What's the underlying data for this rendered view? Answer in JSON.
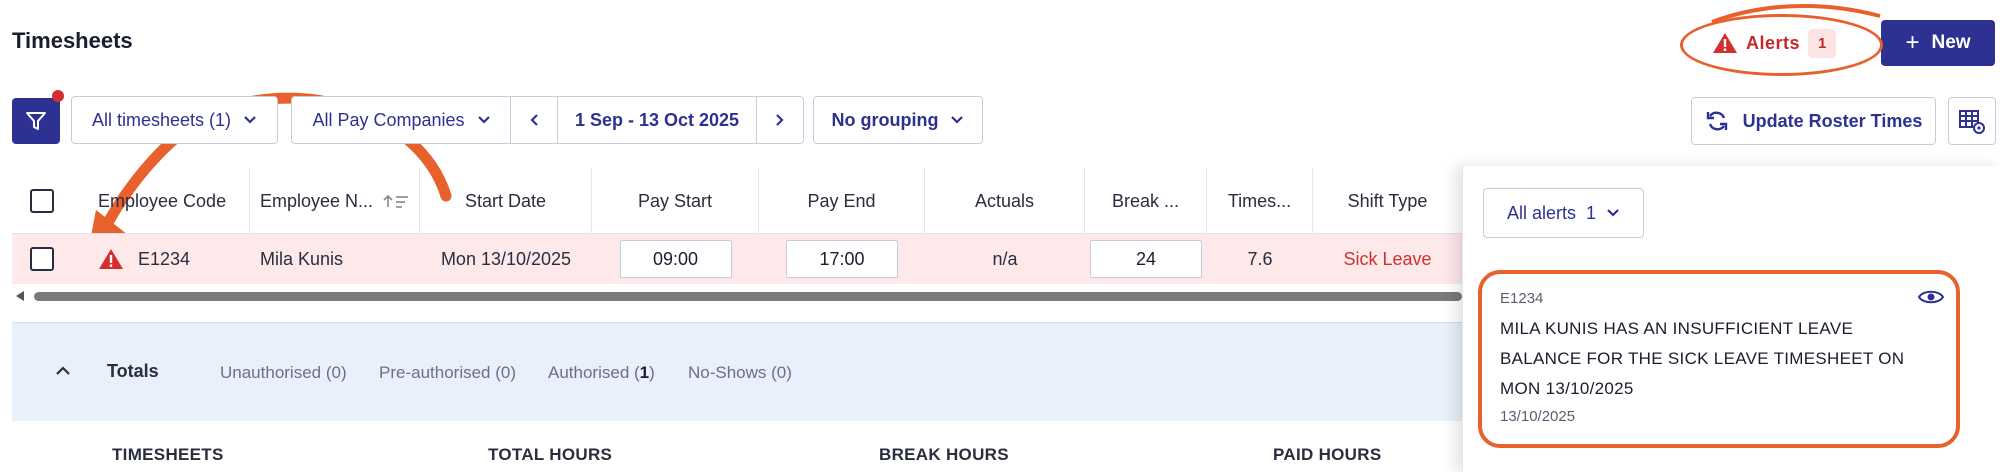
{
  "page": {
    "title": "Timesheets"
  },
  "header": {
    "alerts_label": "Alerts",
    "alerts_count": "1",
    "new_label": "New",
    "accent_color": "#2d3292",
    "alert_color": "#c62828"
  },
  "filters": {
    "timesheets": "All timesheets (1)",
    "pay_companies": "All Pay Companies",
    "date_range": "1 Sep - 13 Oct 2025",
    "grouping": "No grouping",
    "update_roster": "Update Roster Times"
  },
  "table": {
    "columns": [
      "Employee Code",
      "Employee N...",
      "Start Date",
      "Pay Start",
      "Pay End",
      "Actuals",
      "Break ...",
      "Times...",
      "Shift Type"
    ],
    "rows": [
      {
        "employee_code": "E1234",
        "employee_name": "Mila Kunis",
        "start_date": "Mon 13/10/2025",
        "pay_start": "09:00",
        "pay_end": "17:00",
        "actuals": "n/a",
        "break": "24",
        "timesheet_hours": "7.6",
        "shift_type": "Sick Leave"
      }
    ]
  },
  "totals": {
    "title": "Totals",
    "tabs": {
      "unauthorised": "Unauthorised (0)",
      "preauthorised": "Pre-authorised (0)",
      "authorised_prefix": "Authorised (",
      "authorised_count": "1",
      "authorised_suffix": ")",
      "noshows": "No-Shows (0)"
    },
    "columns": [
      "TIMESHEETS",
      "TOTAL HOURS",
      "BREAK HOURS",
      "PAID HOURS"
    ]
  },
  "alerts_panel": {
    "filter_label": "All alerts",
    "filter_count": "1",
    "card": {
      "code": "E1234",
      "message": "MILA KUNIS HAS AN INSUFFICIENT LEAVE BALANCE FOR THE SICK LEAVE TIMESHEET ON MON 13/10/2025",
      "date": "13/10/2025"
    }
  }
}
